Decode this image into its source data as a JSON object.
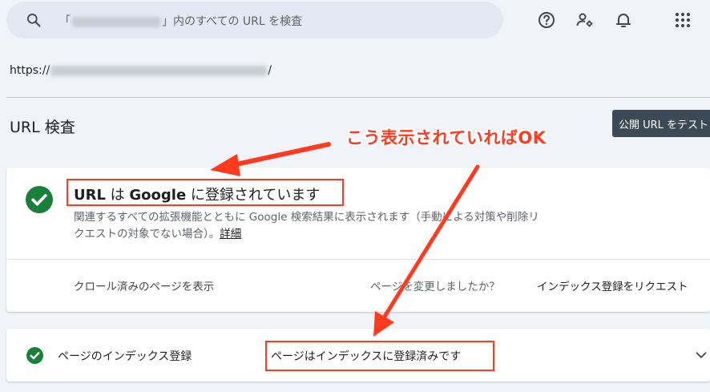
{
  "search": {
    "placeholder_prefix": "「",
    "placeholder_suffix": "」内のすべての URL を検査"
  },
  "url": {
    "prefix": "https://",
    "suffix": "/"
  },
  "page_title": "URL 検査",
  "test_button_label": "公開 URL をテスト",
  "annotation": "こう表示されていればOK",
  "status": {
    "title_parts": [
      "URL",
      " は ",
      "Google",
      " に登録されています"
    ],
    "description": "関連するすべての拡張機能とともに Google 検索結果に表示されます（手動による対策や削除リクエストの対象でない場合）。",
    "detail_link": "詳細",
    "actions": {
      "crawled": "クロール済みのページを表示",
      "changed": "ページを変更しましたか？",
      "request": "インデックス登録をリクエスト"
    }
  },
  "index": {
    "label": "ページのインデックス登録",
    "status": "ページはインデックスに登録済みです"
  },
  "colors": {
    "background": "#f0f4f9",
    "accent_green": "#188038",
    "annotation_red": "#ff3b1f",
    "button_dark": "#3c4a56"
  },
  "icons": {
    "search": "search-icon",
    "help": "help-icon",
    "users": "users-settings-icon",
    "notifications": "bell-icon",
    "apps": "apps-grid-icon",
    "check": "check-circle-icon",
    "expand": "chevron-down-icon"
  }
}
